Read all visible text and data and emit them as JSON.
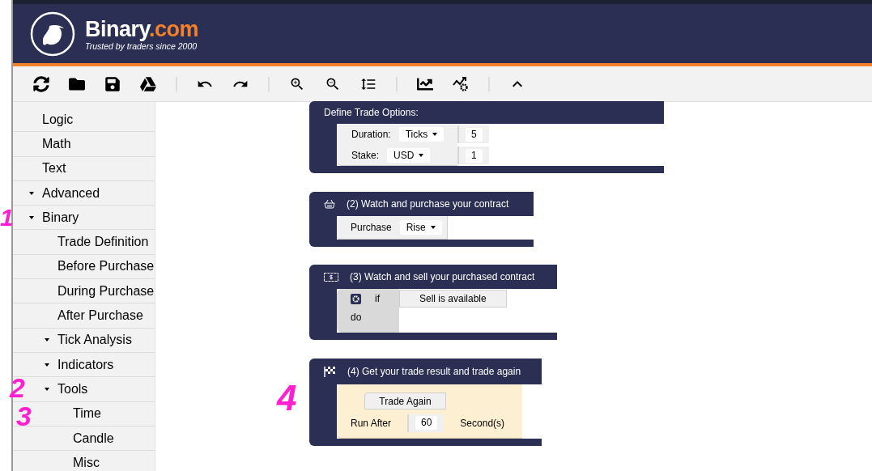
{
  "header": {
    "brand": "Binary",
    "brand_suffix": ".com",
    "tagline": "Trusted by traders since 2000"
  },
  "sidebar": {
    "items": [
      {
        "label": "Logic"
      },
      {
        "label": "Math"
      },
      {
        "label": "Text"
      },
      {
        "label": "Advanced",
        "expanded": true
      },
      {
        "label": "Binary",
        "expanded": true,
        "children": [
          {
            "label": "Trade Definition"
          },
          {
            "label": "Before Purchase"
          },
          {
            "label": "During Purchase"
          },
          {
            "label": "After Purchase"
          },
          {
            "label": "Tick Analysis",
            "expanded": true
          },
          {
            "label": "Indicators",
            "expanded": true
          },
          {
            "label": "Tools",
            "expanded": true,
            "children": [
              {
                "label": "Time"
              },
              {
                "label": "Candle"
              },
              {
                "label": "Misc"
              }
            ]
          }
        ]
      }
    ]
  },
  "blocks": [
    {
      "kind": "trade_options",
      "title": "Define Trade Options:",
      "rows": [
        {
          "label": "Duration:",
          "dropdown": "Ticks",
          "value": "5"
        },
        {
          "label": "Stake:",
          "dropdown": "USD",
          "value": "1"
        }
      ]
    },
    {
      "kind": "purchase",
      "title": "(2) Watch and purchase your contract",
      "label": "Purchase",
      "dropdown": "Rise"
    },
    {
      "kind": "sell",
      "title": "(3) Watch and sell your purchased contract",
      "if_label": "if",
      "condition": "Sell is available",
      "do_label": "do"
    },
    {
      "kind": "trade_again",
      "title": "(4) Get your trade result and trade again",
      "action": "Trade Again",
      "run_label": "Run After",
      "value": "60",
      "unit": "Second(s)"
    }
  ],
  "annotations": [
    {
      "text": "1"
    },
    {
      "text": "2"
    },
    {
      "text": "3"
    },
    {
      "text": "4"
    }
  ]
}
